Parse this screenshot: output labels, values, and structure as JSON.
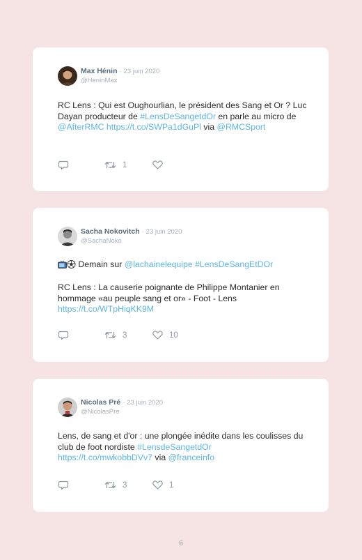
{
  "tweets": [
    {
      "author": "Max Hénin",
      "sep": "·",
      "date": "23 juin 2020",
      "handle": "@HeninMax",
      "body": [
        {
          "t": "RC Lens : Qui est Oughourlian, le président des Sang et Or ? Luc Dayan producteur de ",
          "link": false
        },
        {
          "t": "#LensDeSangetdOr",
          "link": true
        },
        {
          "t": " en parle au micro de ",
          "link": false
        },
        {
          "t": "@AfterRMC",
          "link": true
        },
        {
          "t": " ",
          "link": false
        },
        {
          "t": "https://t.co/SWPa1dGuPl",
          "link": true
        },
        {
          "t": " via ",
          "link": false
        },
        {
          "t": "@RMCSport",
          "link": true
        }
      ],
      "retweets": "1",
      "likes": ""
    },
    {
      "author": "Sacha Nokovitch",
      "sep": "·",
      "date": "23 juin 2020",
      "handle": "@SachaNoko",
      "line1": [
        {
          "t": " Demain sur ",
          "link": false
        },
        {
          "t": "@lachainelequipe",
          "link": true
        },
        {
          "t": " ",
          "link": false
        },
        {
          "t": "#LensDeSangEtDOr",
          "link": true
        }
      ],
      "body": [
        {
          "t": "RC Lens : La causerie poignante de Philippe Montanier en hommage «au peuple sang et or» - Foot - Lens ",
          "link": false
        },
        {
          "t": "https://t.co/WTpHiqKK9M",
          "link": true
        }
      ],
      "retweets": "3",
      "likes": "10"
    },
    {
      "author": "Nicolas Pré",
      "sep": "·",
      "date": "23 juin 2020",
      "handle": "@NicolasPre",
      "body": [
        {
          "t": "Lens, de sang et d'or : une plongée inédite dans les coulisses du club de foot nordiste ",
          "link": false
        },
        {
          "t": "#LensdeSangetdOr",
          "link": true
        },
        {
          "t": " ",
          "link": false
        },
        {
          "t": "https://t.co/mwkobbDVv7",
          "link": true
        },
        {
          "t": " via ",
          "link": false
        },
        {
          "t": "@franceinfo",
          "link": true
        }
      ],
      "retweets": "3",
      "likes": "1"
    }
  ],
  "page_number": "6",
  "colors": {
    "background": "#f6e3e3",
    "card": "#ffffff",
    "link": "#5bb6e6",
    "name": "#5b6b7b",
    "muted": "#a8b2bc"
  },
  "icons": [
    "reply-icon",
    "retweet-icon",
    "heart-icon",
    "tv-emoji-icon",
    "soccer-ball-emoji-icon"
  ]
}
